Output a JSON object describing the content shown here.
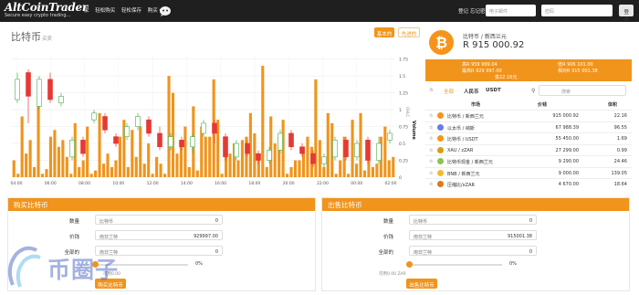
{
  "nav": {
    "logo_main": "AltCoinTrader",
    "logo_sub": "Secure easy crypto trading...",
    "links": [
      "家",
      "轻松购买",
      "轻松保存",
      "购买 ▾"
    ],
    "login": "登记",
    "forgot": "忘记密码",
    "email_placeholder": "电子邮件",
    "password_placeholder": "密码",
    "login_btn": "登录"
  },
  "chart": {
    "title": "比特币",
    "title_small": "买卖",
    "btn_buy": "基本的",
    "btn_advanced": "先进的",
    "volume_label": "Volume",
    "side_label": "OHLC"
  },
  "chart_data": {
    "type": "bar",
    "x_ticks": [
      "04:00",
      "06:00",
      "08:00",
      "10:00",
      "12:00",
      "14:00",
      "16:00",
      "18:00",
      "20:00",
      "22:00",
      "00:00",
      "02:00"
    ],
    "y_ticks": [
      "0",
      "0.25",
      "0.5",
      "0.75",
      "1",
      "1.25",
      "1.5",
      "1.75"
    ],
    "ylim": [
      0,
      1.8
    ],
    "volume": [
      0.25,
      0.05,
      0.9,
      0.35,
      0.55,
      0.15,
      1.05,
      0.05,
      0.12,
      0.6,
      0.7,
      0.45,
      0.55,
      0.3,
      0.05,
      0.8,
      0.15,
      0.25,
      0.75,
      0.05,
      0.1,
      0.95,
      0.2,
      0.35,
      0.15,
      0.25,
      0.6,
      0.85,
      0.15,
      0.7,
      0.3,
      0.75,
      0.2,
      0.5,
      0.05,
      0.3,
      0.2,
      0.05,
      1.5,
      1.25,
      0.35,
      0.45,
      0.75,
      0.15,
      1.05,
      0.1,
      0.75,
      0.6,
      0.6,
      1.45,
      0.85,
      0.05,
      0.3,
      0.35,
      0.5,
      0.25,
      0.55,
      0.6,
      0.95,
      0.65,
      0.25,
      1.65,
      0.15,
      0.9,
      0.5,
      0.6,
      0.85,
      0.05,
      0.15,
      0.25,
      0.25,
      0.45,
      0.6,
      0.45,
      1.45,
      0.55,
      0.15,
      0.95,
      0.8,
      0.05,
      0.25,
      0.6,
      0.05,
      0.85,
      0.2,
      0.95,
      0.1,
      0.5,
      0.15,
      0.2,
      0.6,
      0.75,
      0.25,
      0.3
    ],
    "candles": [
      {
        "o": 1.15,
        "c": 1.45,
        "h": 1.55,
        "l": 1.1
      },
      {
        "o": 1.55,
        "c": 1.2,
        "h": 1.6,
        "l": 0.8
      },
      {
        "o": 1.05,
        "c": 1.45,
        "h": 1.5,
        "l": 1.0
      },
      {
        "o": 1.45,
        "c": 1.15,
        "h": 1.55,
        "l": 1.1
      },
      {
        "o": 1.1,
        "c": 1.2,
        "h": 1.25,
        "l": 1.05
      },
      {
        "o": 0.3,
        "c": 0.55,
        "h": 0.6,
        "l": 0.25
      },
      {
        "o": 0.55,
        "c": 0.35,
        "h": 0.6,
        "l": 0.3
      },
      {
        "o": 0.85,
        "c": 0.95,
        "h": 1.0,
        "l": 0.8
      },
      {
        "o": 0.9,
        "c": 0.7,
        "h": 0.95,
        "l": 0.65
      },
      {
        "o": 0.6,
        "c": 0.5,
        "h": 0.65,
        "l": 0.45
      },
      {
        "o": 0.6,
        "c": 0.75,
        "h": 0.8,
        "l": 0.55
      },
      {
        "o": 0.75,
        "c": 0.9,
        "h": 0.95,
        "l": 0.7
      },
      {
        "o": 0.85,
        "c": 0.65,
        "h": 0.9,
        "l": 0.6
      },
      {
        "o": 0.65,
        "c": 0.45,
        "h": 0.75,
        "l": 0.4
      },
      {
        "o": 0.45,
        "c": 0.6,
        "h": 0.65,
        "l": 0.4
      },
      {
        "o": 0.55,
        "c": 0.45,
        "h": 0.6,
        "l": 0.4
      },
      {
        "o": 0.45,
        "c": 0.6,
        "h": 0.65,
        "l": 0.35
      },
      {
        "o": 0.65,
        "c": 0.8,
        "h": 0.85,
        "l": 0.6
      },
      {
        "o": 0.8,
        "c": 0.65,
        "h": 0.85,
        "l": 0.5
      },
      {
        "o": 0.6,
        "c": 0.3,
        "h": 0.65,
        "l": 0.25
      },
      {
        "o": 0.3,
        "c": 0.5,
        "h": 0.55,
        "l": 0.25
      },
      {
        "o": 0.5,
        "c": 0.35,
        "h": 0.55,
        "l": 0.3
      },
      {
        "o": 0.35,
        "c": 0.25,
        "h": 0.4,
        "l": 0.2
      },
      {
        "o": 0.25,
        "c": 0.4,
        "h": 0.45,
        "l": 0.2
      },
      {
        "o": 0.4,
        "c": 0.65,
        "h": 0.7,
        "l": 0.35
      },
      {
        "o": 0.65,
        "c": 0.45,
        "h": 0.7,
        "l": 0.4
      },
      {
        "o": 0.45,
        "c": 0.35,
        "h": 0.5,
        "l": 0.3
      },
      {
        "o": 0.35,
        "c": 0.2,
        "h": 0.4,
        "l": 0.15
      },
      {
        "o": 0.2,
        "c": 0.3,
        "h": 0.35,
        "l": 0.15
      },
      {
        "o": 0.3,
        "c": 0.55,
        "h": 0.6,
        "l": 0.25
      },
      {
        "o": 0.55,
        "c": 0.3,
        "h": 0.6,
        "l": 0.25
      },
      {
        "o": 0.3,
        "c": 0.5,
        "h": 0.55,
        "l": 0.25
      },
      {
        "o": 0.55,
        "c": 0.25,
        "h": 0.6,
        "l": 0.2
      },
      {
        "o": 0.25,
        "c": 0.5,
        "h": 0.6,
        "l": 0.2
      },
      {
        "o": 0.55,
        "c": 0.65,
        "h": 0.7,
        "l": 0.5
      }
    ]
  },
  "pair": {
    "name": "比特币 / 新西兰元",
    "price": "R 915 000.92"
  },
  "stats": {
    "high": "高R 959 999.04",
    "low": "低R 906 101.00",
    "avg": "最高R 929 997.00",
    "change": "相对R 915 001.38",
    "vol": "变22.16元"
  },
  "tabs": {
    "all": "全部",
    "rmb": "人民币",
    "usdt": "USDT",
    "search_placeholder": "搜索"
  },
  "market": {
    "headers": [
      "市场",
      "价钱",
      "体积"
    ],
    "rows": [
      {
        "name": "比特币 / 新西兰元",
        "price": "915 000.92",
        "vol": "22.16",
        "color": "#f7931a"
      },
      {
        "name": "以太币 / 纳斯",
        "price": "67 988.39",
        "vol": "96.55",
        "color": "#627eea"
      },
      {
        "name": "比特币 / USDT",
        "price": "55 450.00",
        "vol": "1.69",
        "color": "#f7931a"
      },
      {
        "name": "XAU / zZAR",
        "price": "27 299.00",
        "vol": "0.99",
        "color": "#d4a017"
      },
      {
        "name": "比特币现金 / 新西兰元",
        "price": "9 290.00",
        "vol": "24.46",
        "color": "#8dc351"
      },
      {
        "name": "BNB / 新西兰元",
        "price": "9 000.00",
        "vol": "139.05",
        "color": "#f3ba2f"
      },
      {
        "name": "压缩比/xZAR",
        "price": "4 670.00",
        "vol": "18.64",
        "color": "#e2761b"
      }
    ]
  },
  "buy": {
    "title": "购买比特币",
    "amount_label": "数量",
    "amount_ph": "比特币",
    "amount_val": "0",
    "price_label": "价钱",
    "price_ph": "南非兰特",
    "price_val": "929997.00",
    "total_label": "全部的",
    "total_ph": "南非兰特",
    "total_val": "0",
    "pct": "0%",
    "balance": "可用0.00",
    "button": "购买比特币"
  },
  "sell": {
    "title": "出售比特币",
    "amount_label": "数量",
    "amount_ph": "比特币",
    "amount_val": "0",
    "price_label": "价钱",
    "price_ph": "南非兰特",
    "price_val": "915001.38",
    "total_label": "全部的",
    "total_ph": "南非兰特",
    "total_val": "0",
    "pct": "0%",
    "balance": "可用0.00 ZAR",
    "button": "出售比特币"
  },
  "watermark": "币圈子",
  "colors": {
    "accent": "#f0941b",
    "up": "#4caf50",
    "down": "#e53935",
    "nav": "#1f1f1f"
  }
}
